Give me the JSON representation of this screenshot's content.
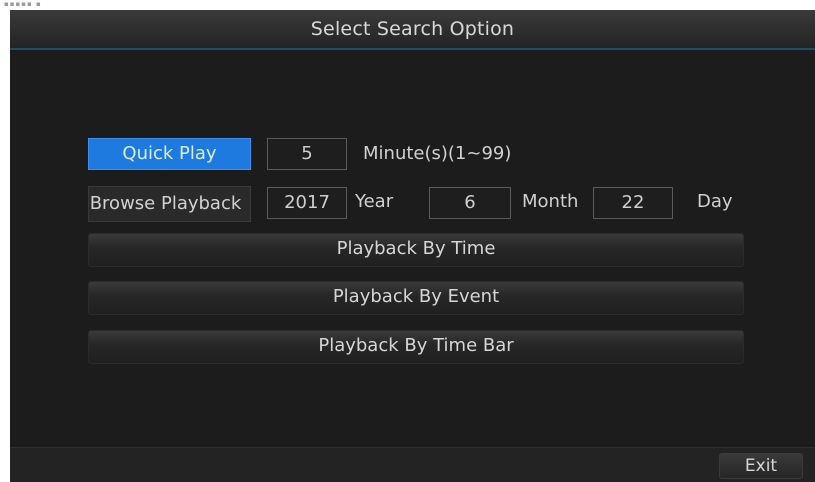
{
  "window": {
    "title": "Select Search Option"
  },
  "quick_play": {
    "button_label": "Quick Play",
    "minutes_value": "5",
    "minutes_hint": "Minute(s)(1~99)"
  },
  "browse_playback": {
    "button_label": "Browse Playback",
    "year_value": "2017",
    "year_label": "Year",
    "month_value": "6",
    "month_label": "Month",
    "day_value": "22",
    "day_label": "Day"
  },
  "menu": {
    "by_time": "Playback By Time",
    "by_event": "Playback By Event",
    "by_time_bar": "Playback By Time Bar"
  },
  "footer": {
    "exit_label": "Exit"
  },
  "colors": {
    "accent": "#1f7ae0",
    "title_rule": "#1d4f6f",
    "panel": "#1c1c1c"
  }
}
